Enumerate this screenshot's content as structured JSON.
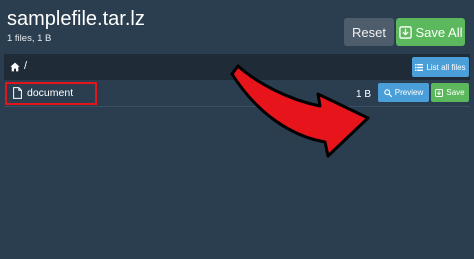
{
  "header": {
    "title": "samplefile.tar.lz",
    "subtitle": "1 files, 1 B",
    "reset_label": "Reset",
    "save_all_label": "Save All"
  },
  "pathbar": {
    "separator": "/",
    "list_all_label": "List all files"
  },
  "files": [
    {
      "name": "document",
      "size": "1 B",
      "preview_label": "Preview",
      "save_label": "Save",
      "highlighted": true
    }
  ],
  "colors": {
    "background": "#2b3e50",
    "pathbar": "#1f2b36",
    "primary": "#4a9fd9",
    "success": "#5cb85c",
    "secondary": "#4e5d6c",
    "annotation": "#e3151a"
  },
  "icons": {
    "save_all": "download-box-icon",
    "home": "home-icon",
    "list": "list-icon",
    "file": "file-icon",
    "preview": "search-icon",
    "save": "download-box-icon",
    "annotation_arrow": "curved-arrow-icon"
  }
}
